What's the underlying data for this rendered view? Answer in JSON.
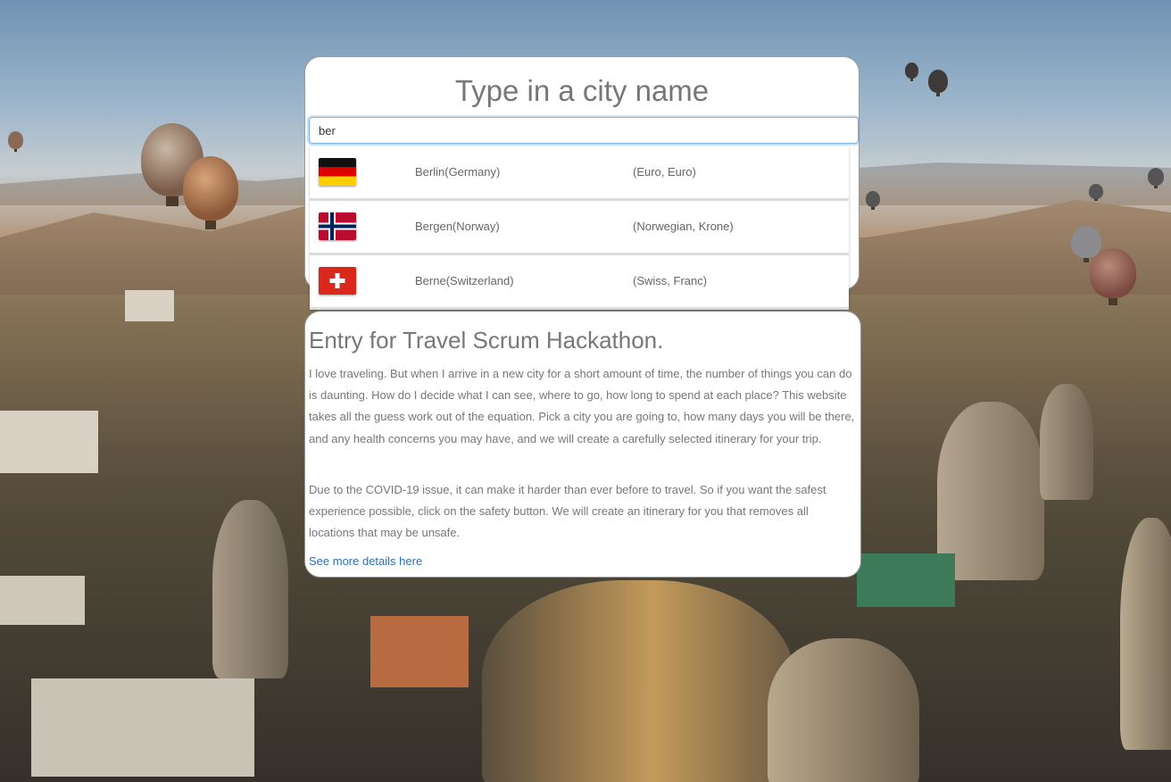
{
  "search": {
    "title": "Type in a city name",
    "value": "ber",
    "placeholder": ""
  },
  "results": [
    {
      "flag": "germany-flag",
      "city": "Berlin(Germany)",
      "currency": "(Euro, Euro)"
    },
    {
      "flag": "norway-flag",
      "city": "Bergen(Norway)",
      "currency": "(Norwegian, Krone)"
    },
    {
      "flag": "switzerland-flag",
      "city": "Berne(Switzerland)",
      "currency": "(Swiss, Franc)"
    }
  ],
  "info": {
    "title": "Entry for Travel Scrum Hackathon.",
    "paragraph1": "I love traveling. But when I arrive in a new city for a short amount of time, the number of things you can do is daunting. How do I decide what I can see, where to go, how long to spend at each place? This website takes all the guess work out of the equation. Pick a city you are going to, how many days you will be there, and any health concerns you may have, and we will create a carefully selected itinerary for your trip.",
    "paragraph2": "Due to the COVID-19 issue, it can make it harder than ever before to travel. So if you want the safest experience possible, click on the safety button. We will create an itinerary for you that removes all locations that may be unsafe.",
    "link": "See more details here"
  },
  "colors": {
    "link": "#2a73b8",
    "text": "#777777",
    "input_focus": "#7fb3e6"
  }
}
